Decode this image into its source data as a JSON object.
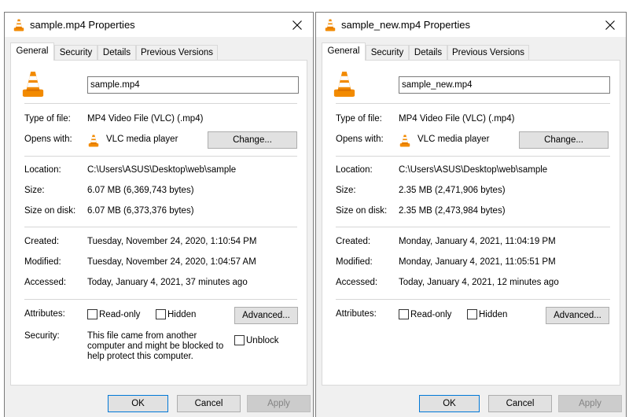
{
  "dialogs": [
    {
      "title": "sample.mp4 Properties",
      "tabs": [
        "General",
        "Security",
        "Details",
        "Previous Versions"
      ],
      "active_tab": "General",
      "file_name": "sample.mp4",
      "type_of_file_label": "Type of file:",
      "type_of_file": "MP4 Video File (VLC) (.mp4)",
      "opens_with_label": "Opens with:",
      "opens_with": "VLC media player",
      "change_label": "Change...",
      "location_label": "Location:",
      "location": "C:\\Users\\ASUS\\Desktop\\web\\sample",
      "size_label": "Size:",
      "size": "6.07 MB (6,369,743 bytes)",
      "size_on_disk_label": "Size on disk:",
      "size_on_disk": "6.07 MB (6,373,376 bytes)",
      "created_label": "Created:",
      "created": "Tuesday, November 24, 2020, 1:10:54 PM",
      "modified_label": "Modified:",
      "modified": "Tuesday, November 24, 2020, 1:04:57 AM",
      "accessed_label": "Accessed:",
      "accessed": "Today, January 4, 2021, 37 minutes ago",
      "attributes_label": "Attributes:",
      "read_only_label": "Read-only",
      "read_only_checked": false,
      "hidden_label": "Hidden",
      "hidden_checked": false,
      "advanced_label": "Advanced...",
      "security_label": "Security:",
      "security_text": "This file came from another computer and might be blocked to help protect this computer.",
      "unblock_label": "Unblock",
      "unblock_checked": false,
      "ok_label": "OK",
      "cancel_label": "Cancel",
      "apply_label": "Apply"
    },
    {
      "title": "sample_new.mp4 Properties",
      "tabs": [
        "General",
        "Security",
        "Details",
        "Previous Versions"
      ],
      "active_tab": "General",
      "file_name": "sample_new.mp4",
      "type_of_file_label": "Type of file:",
      "type_of_file": "MP4 Video File (VLC) (.mp4)",
      "opens_with_label": "Opens with:",
      "opens_with": "VLC media player",
      "change_label": "Change...",
      "location_label": "Location:",
      "location": "C:\\Users\\ASUS\\Desktop\\web\\sample",
      "size_label": "Size:",
      "size": "2.35 MB (2,471,906 bytes)",
      "size_on_disk_label": "Size on disk:",
      "size_on_disk": "2.35 MB (2,473,984 bytes)",
      "created_label": "Created:",
      "created": "Monday, January 4, 2021, 11:04:19 PM",
      "modified_label": "Modified:",
      "modified": "Monday, January 4, 2021, 11:05:51 PM",
      "accessed_label": "Accessed:",
      "accessed": "Today, January 4, 2021, 12 minutes ago",
      "attributes_label": "Attributes:",
      "read_only_label": "Read-only",
      "read_only_checked": false,
      "hidden_label": "Hidden",
      "hidden_checked": false,
      "advanced_label": "Advanced...",
      "ok_label": "OK",
      "cancel_label": "Cancel",
      "apply_label": "Apply"
    }
  ],
  "icons": {
    "title": "vlc-cone-icon",
    "file": "vlc-cone-icon",
    "opens_with": "vlc-cone-icon",
    "close": "close-icon"
  },
  "colors": {
    "vlc_orange": "#f28a00",
    "dialog_bg": "#f0f0f0",
    "panel_bg": "#ffffff",
    "primary_border": "#0078d7",
    "disabled_bg": "#cccccc"
  }
}
